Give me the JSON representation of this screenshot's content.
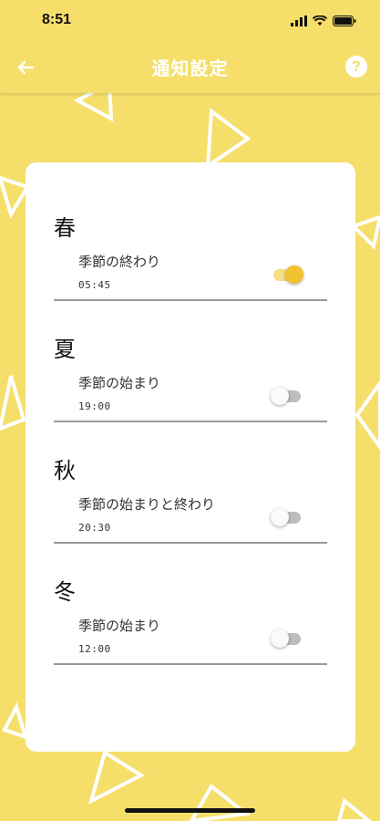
{
  "status_bar": {
    "time": "8:51"
  },
  "header": {
    "title": "通知設定",
    "help_glyph": "?"
  },
  "sections": [
    {
      "season": "春",
      "label": "季節の終わり",
      "time": "05:45",
      "enabled": true
    },
    {
      "season": "夏",
      "label": "季節の始まり",
      "time": "19:00",
      "enabled": false
    },
    {
      "season": "秋",
      "label": "季節の始まりと終わり",
      "time": "20:30",
      "enabled": false
    },
    {
      "season": "冬",
      "label": "季節の始まり",
      "time": "12:00",
      "enabled": false
    }
  ],
  "colors": {
    "background": "#f5df6a",
    "card": "#ffffff",
    "toggle_on_thumb": "#f2c12e",
    "toggle_on_track": "#f7dc86",
    "toggle_off_track": "#bdbdbd"
  },
  "icons": {
    "back": "arrow-left-icon",
    "help": "question-circle-icon"
  }
}
